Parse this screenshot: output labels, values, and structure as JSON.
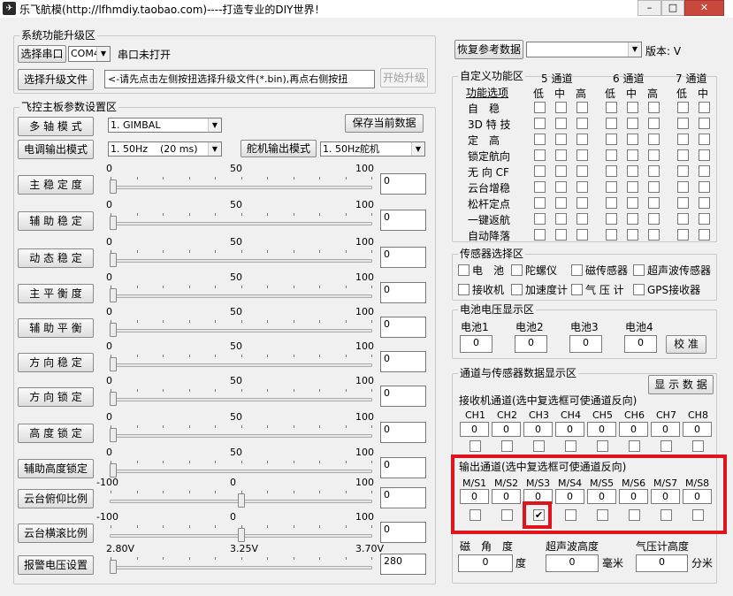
{
  "window": {
    "title": "乐飞航模(http://lfhmdiy.taobao.com)----打造专业的DIY世界！",
    "min": "–",
    "max": "□",
    "close": "✕"
  },
  "upgrade": {
    "group_title": "系统功能升级区",
    "select_port_label": "选择串口",
    "port_value": "COM4",
    "port_status": "串口未打开",
    "select_file_label": "选择升级文件",
    "file_hint": "<-请先点击左侧按扭选择升级文件(*.bin),再点右侧按扭",
    "start_label": "开始升级"
  },
  "params": {
    "group_title": "飞控主板参数设置区",
    "multi_axis_label": "多 轴 模 式",
    "multi_axis_value": "1. GIMBAL",
    "save_label": "保存当前数据",
    "esc_label": "电调输出模式",
    "esc_value": "1. 50Hz    (20 ms)",
    "servo_label": "舵机输出模式",
    "servo_value": "1. 50Hz舵机",
    "sliders": [
      {
        "label": "主 稳 定 度",
        "min": "0",
        "mid": "50",
        "max": "100",
        "value": "0",
        "pos": 0
      },
      {
        "label": "辅 助 稳 定",
        "min": "0",
        "mid": "50",
        "max": "100",
        "value": "0",
        "pos": 0
      },
      {
        "label": "动 态 稳 定",
        "min": "0",
        "mid": "50",
        "max": "100",
        "value": "0",
        "pos": 0
      },
      {
        "label": "主 平 衡 度",
        "min": "0",
        "mid": "50",
        "max": "100",
        "value": "0",
        "pos": 0
      },
      {
        "label": "辅 助 平 衡",
        "min": "0",
        "mid": "50",
        "max": "100",
        "value": "0",
        "pos": 0
      },
      {
        "label": "方 向 稳 定",
        "min": "0",
        "mid": "50",
        "max": "100",
        "value": "0",
        "pos": 0
      },
      {
        "label": "方 向 锁 定",
        "min": "0",
        "mid": "50",
        "max": "100",
        "value": "0",
        "pos": 0
      },
      {
        "label": "高 度 锁 定",
        "min": "0",
        "mid": "50",
        "max": "100",
        "value": "0",
        "pos": 0
      },
      {
        "label": "辅助高度锁定",
        "min": "0",
        "mid": "50",
        "max": "100",
        "value": "0",
        "pos": 0
      },
      {
        "label": "云台俯仰比例",
        "min": "-100",
        "mid": "0",
        "max": "100",
        "value": "0",
        "pos": 0.5
      },
      {
        "label": "云台横滚比例",
        "min": "-100",
        "mid": "0",
        "max": "100",
        "value": "0",
        "pos": 0.5
      },
      {
        "label": "报警电压设置",
        "min": "2.80V",
        "mid": "3.25V",
        "max": "3.70V",
        "value": "280",
        "pos": 0
      }
    ]
  },
  "restore": {
    "label": "恢复参考数据",
    "value": "",
    "version": "版本: V"
  },
  "custom": {
    "group_title": "自定义功能区",
    "header_options": "功能选项",
    "channels": [
      "5 通道",
      "6 通道",
      "7 通道"
    ],
    "levels": [
      "低",
      "中",
      "高"
    ],
    "rows": [
      "自　稳",
      "3D 特 技",
      "定　高",
      "锁定航向",
      "无 向 CF",
      "云台增稳",
      "松杆定点",
      "一键返航",
      "自动降落"
    ]
  },
  "sensors": {
    "group_title": "传感器选择区",
    "items": [
      "电　池",
      "陀螺仪",
      "磁传感器",
      "超声波传感器",
      "接收机",
      "加速度计",
      "气 压 计",
      "GPS接收器"
    ]
  },
  "battery": {
    "group_title": "电池电压显示区",
    "labels": [
      "电池1",
      "电池2",
      "电池3",
      "电池4"
    ],
    "values": [
      "0",
      "0",
      "0",
      "0"
    ],
    "calibrate": "校 准"
  },
  "channels": {
    "group_title": "通道与传感器数据显示区",
    "show_btn": "显 示 数 据",
    "rx_title": "接收机通道(选中复选框可使通道反向)",
    "rx_labels": [
      "CH1",
      "CH2",
      "CH3",
      "CH4",
      "CH5",
      "CH6",
      "CH7",
      "CH8"
    ],
    "rx_values": [
      "0",
      "0",
      "0",
      "0",
      "0",
      "0",
      "0",
      "0"
    ],
    "out_title": "输出通道(选中复选框可使通道反向)",
    "out_labels": [
      "M/S1",
      "M/S2",
      "M/S3",
      "M/S4",
      "M/S5",
      "M/S6",
      "M/S7",
      "M/S8"
    ],
    "out_values": [
      "0",
      "0",
      "0",
      "0",
      "0",
      "0",
      "0",
      "0"
    ],
    "out_checked": 2,
    "mag_label": "磁　角　度",
    "mag_value": "0",
    "mag_unit": "度",
    "sonar_label": "超声波高度",
    "sonar_value": "0",
    "sonar_unit": "毫米",
    "baro_label": "气压计高度",
    "baro_value": "0",
    "baro_unit": "分米"
  },
  "colors": {
    "accent_red": "#e0141c"
  }
}
